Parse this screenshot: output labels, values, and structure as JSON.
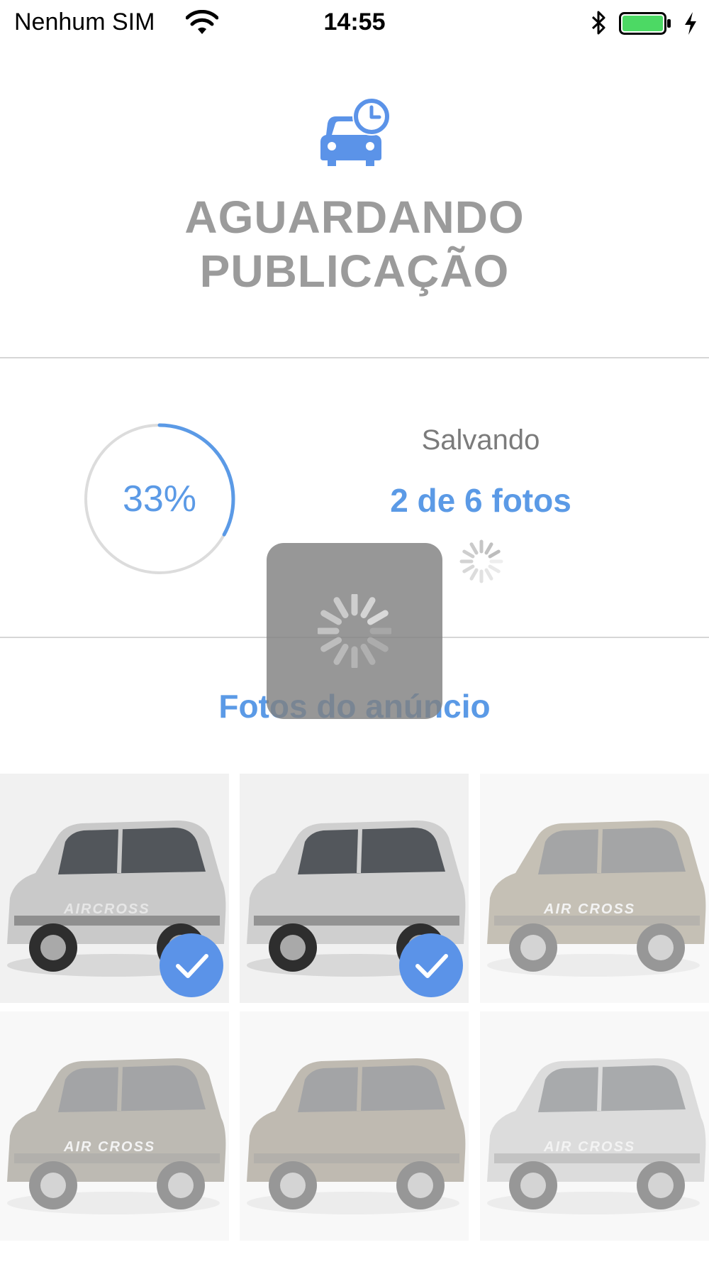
{
  "status_bar": {
    "carrier": "Nenhum SIM",
    "time": "14:55",
    "battery_level": 1.0
  },
  "header": {
    "icon": "car-clock-icon",
    "title_line1": "AGUARDANDO",
    "title_line2": "PUBLICAÇÃO"
  },
  "progress": {
    "percent_label": "33%",
    "fraction": 0.33,
    "status_label": "Salvando",
    "count_label": "2 de 6 fotos"
  },
  "photos": {
    "section_title": "Fotos do anúncio",
    "items": [
      {
        "uploaded": true,
        "color": "#c9c9c9",
        "caption": "AIRCROSS"
      },
      {
        "uploaded": true,
        "color": "#cfcfcf",
        "caption": ""
      },
      {
        "uploaded": false,
        "color": "#8b806a",
        "caption": "AIR CROSS"
      },
      {
        "uploaded": false,
        "color": "#7a7466",
        "caption": "AIR CROSS"
      },
      {
        "uploaded": false,
        "color": "#7f7563",
        "caption": ""
      },
      {
        "uploaded": false,
        "color": "#b9b9b9",
        "caption": "AIR CROSS"
      }
    ]
  },
  "colors": {
    "accent": "#5b9ae6",
    "title_gray": "#9b9b9b",
    "battery_green": "#4cd964"
  }
}
